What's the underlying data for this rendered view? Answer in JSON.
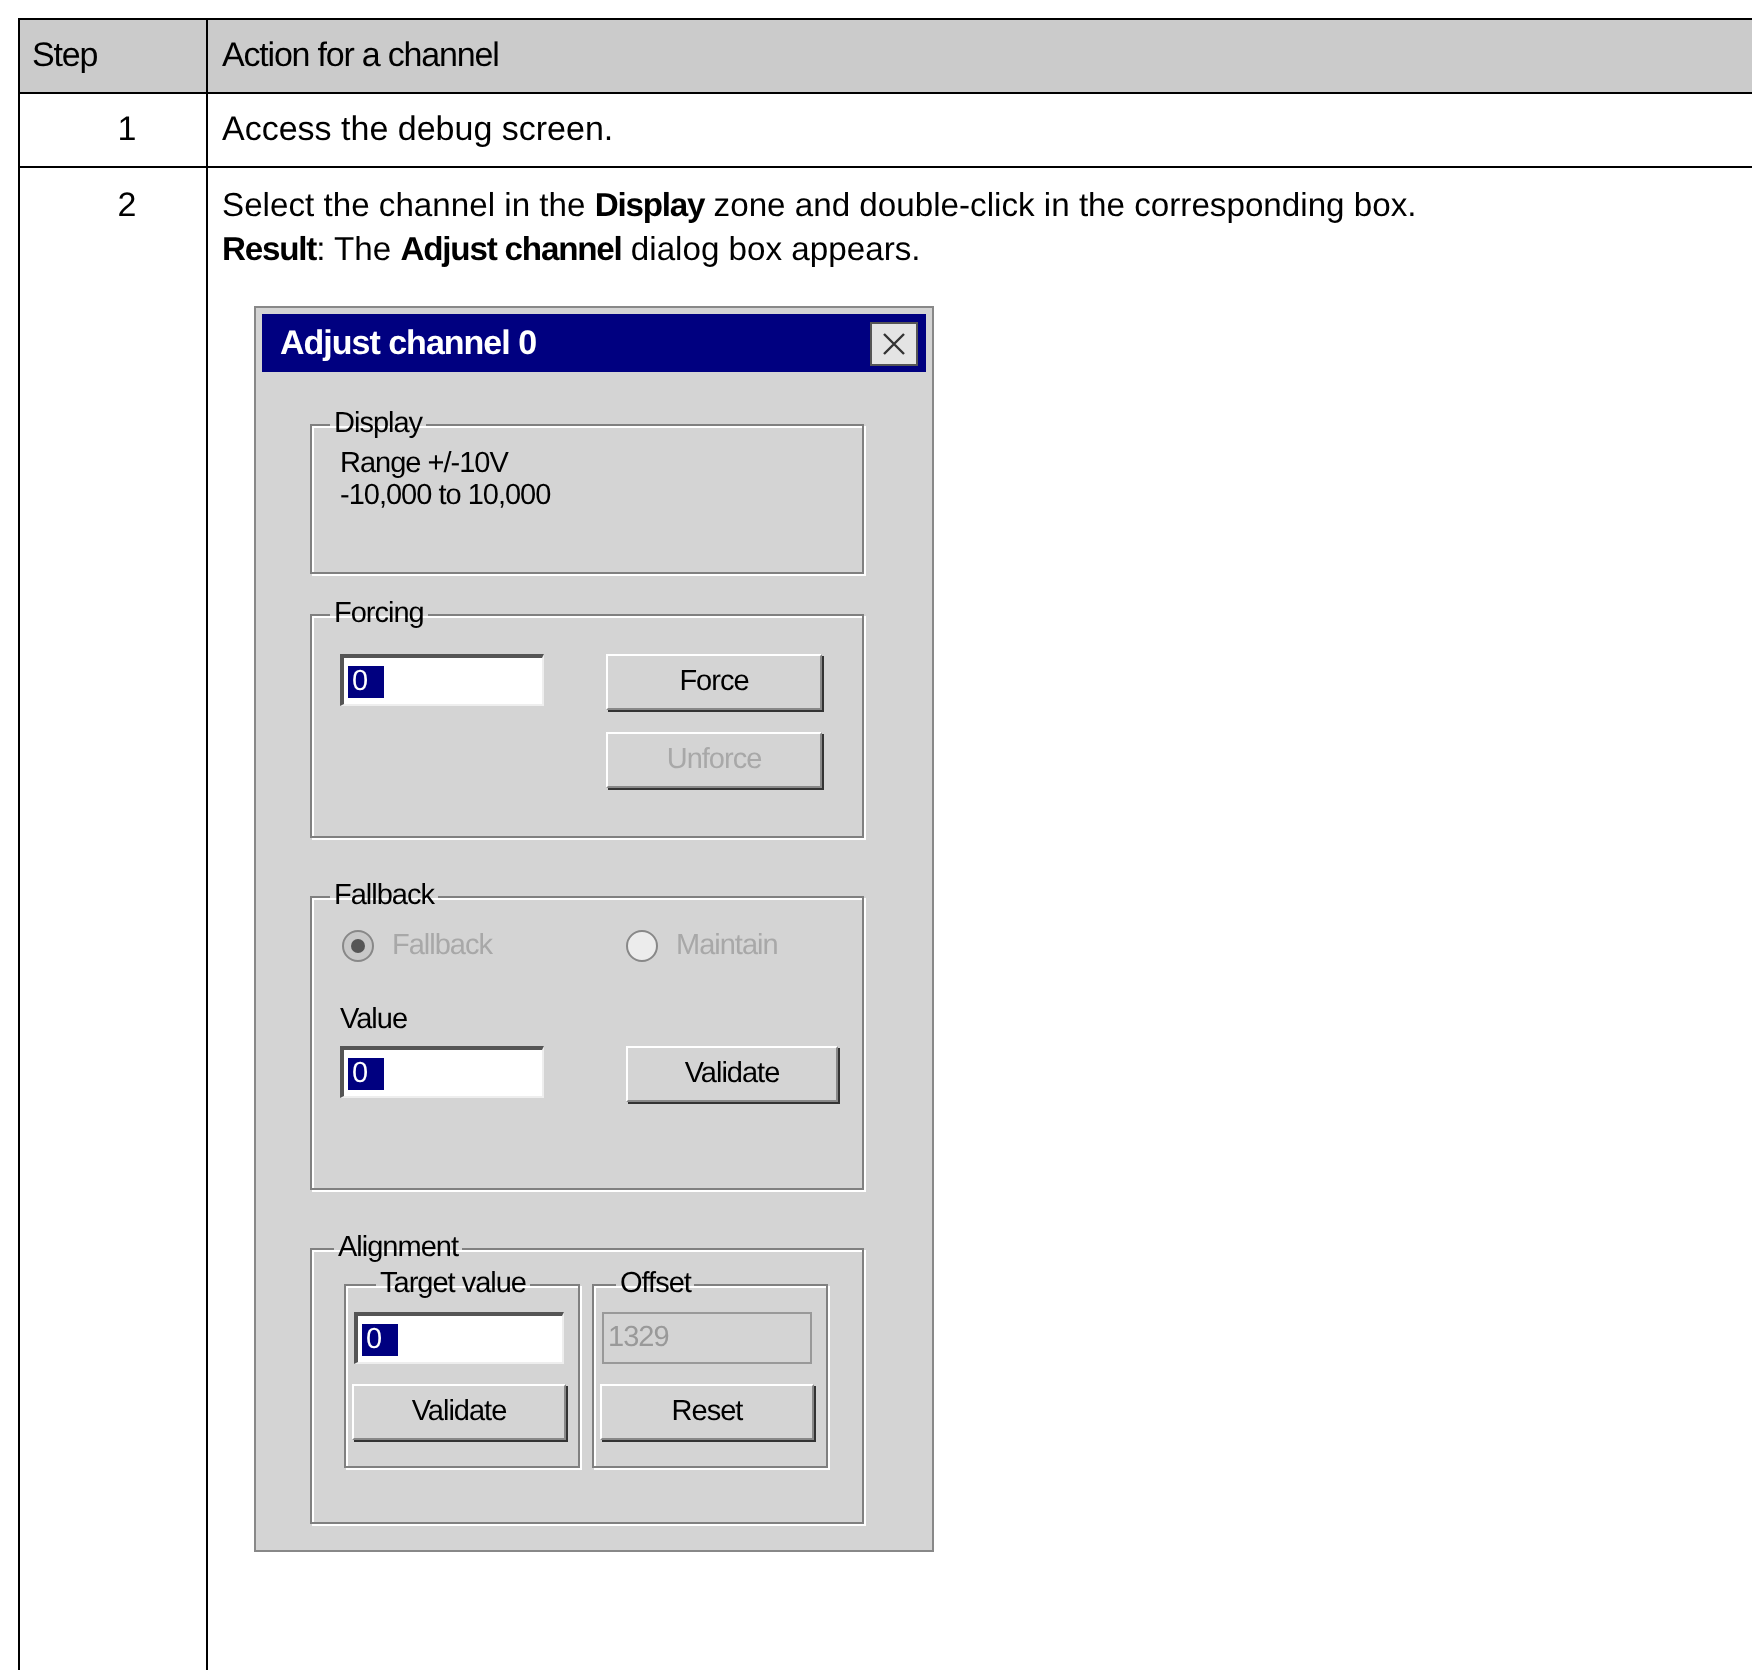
{
  "table": {
    "columns": [
      "Step",
      "Action for a channel"
    ],
    "rows": [
      {
        "step": "1",
        "action": "Access the debug screen."
      },
      {
        "step": "2",
        "action": "Select the channel in the **Display** zone and double-click in the corresponding box.",
        "result": "**Result**: The **Adjust channel** dialog box appears.",
        "dialog": {
          "title": "Adjust channel 0",
          "display": {
            "label": "Display",
            "lines": [
              "Range +/-10V",
              "-10,000 to 10,000"
            ]
          },
          "forcing": {
            "label": "Forcing",
            "field": {
              "value": "0",
              "highlighted": true,
              "disabled": false
            },
            "buttons": [
              {
                "label": "Force",
                "disabled": false
              },
              {
                "label": "Unforce",
                "disabled": true
              }
            ]
          },
          "fallback": {
            "label": "Fallback",
            "radios": [
              {
                "label": "Fallback",
                "selected": true,
                "disabled": true
              },
              {
                "label": "Maintain",
                "selected": false,
                "disabled": true
              }
            ],
            "value_label": "Value",
            "field": {
              "value": "0",
              "highlighted": true,
              "disabled": false
            },
            "button": {
              "label": "Validate",
              "disabled": false
            }
          },
          "alignment": {
            "label": "Alignment",
            "target": {
              "label": "Target value",
              "field": {
                "value": "0",
                "highlighted": true,
                "disabled": false
              },
              "button": {
                "label": "Validate",
                "disabled": false
              }
            },
            "offset": {
              "label": "Offset",
              "field": {
                "value": "1329",
                "highlighted": false,
                "disabled": true
              },
              "button": {
                "label": "Reset",
                "disabled": false
              }
            }
          }
        }
      }
    ]
  }
}
